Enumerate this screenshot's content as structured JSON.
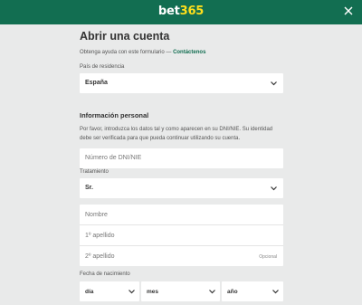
{
  "header": {
    "logo_main": "bet",
    "logo_accent": "365"
  },
  "form": {
    "title": "Abrir una cuenta",
    "help_text": "Obtenga ayuda con este formulario — ",
    "help_link": "Contáctenos",
    "country_label": "País de residencia",
    "country_value": "España",
    "personal_title": "Información personal",
    "personal_desc": "Por favor, introduzca los datos tal y como aparecen en su DNI/NIE. Su identidad debe ser verificada para que pueda continuar utilizando su cuenta.",
    "dni_placeholder": "Número de DNI/NIE",
    "title_label": "Tratamiento",
    "title_value": "Sr.",
    "name_placeholder": "Nombre",
    "surname1_placeholder": "1º apellido",
    "surname2_placeholder": "2º apellido",
    "optional_label": "Opcional",
    "dob_label": "Fecha de nacimiento",
    "dob_day": "día",
    "dob_month": "mes",
    "dob_year": "año"
  },
  "icons": {
    "close": "close-icon",
    "chevron": "chevron-down-icon"
  },
  "colors": {
    "brand": "#126e51",
    "accent": "#ffdf1b",
    "background": "#e9eaea"
  }
}
